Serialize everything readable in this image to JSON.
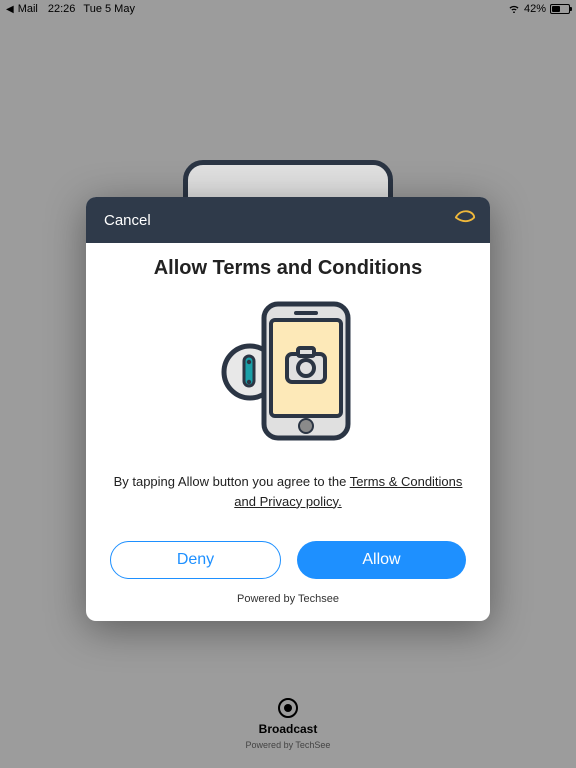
{
  "status": {
    "back_app": "Mail",
    "time": "22:26",
    "date": "Tue 5 May",
    "battery_pct": "42%"
  },
  "bottom": {
    "label": "Broadcast",
    "powered": "Powered by TechSee"
  },
  "modal": {
    "cancel": "Cancel",
    "title": "Allow Terms and Conditions",
    "agree_prefix": "By tapping Allow button you agree to the ",
    "agree_link": "Terms & Conditions and Privacy policy.",
    "deny": "Deny",
    "allow": "Allow",
    "powered": "Powered by Techsee"
  }
}
